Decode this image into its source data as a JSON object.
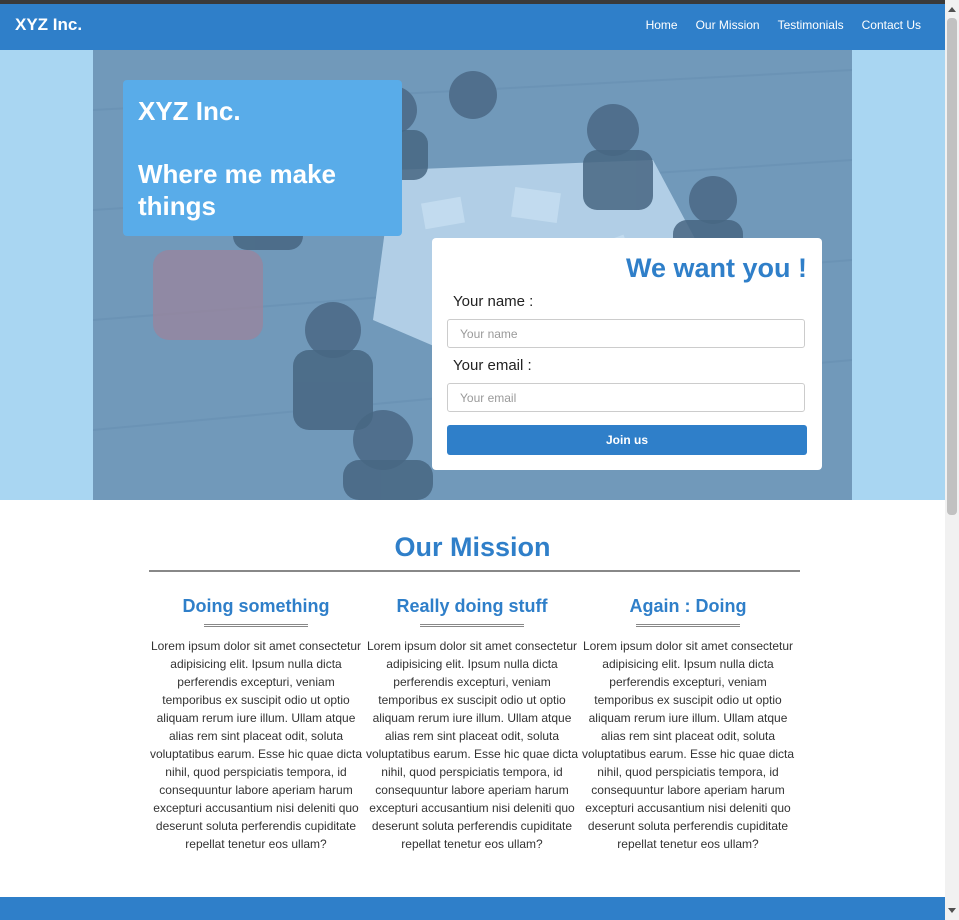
{
  "nav": {
    "brand": "XYZ Inc.",
    "links": [
      "Home",
      "Our Mission",
      "Testimonials",
      "Contact Us"
    ]
  },
  "hero": {
    "intro": {
      "title": "XYZ Inc.",
      "tagline": "Where me make things"
    },
    "form": {
      "title": "We want you !",
      "name_label": "Your name :",
      "name_placeholder": "Your name",
      "email_label": "Your email :",
      "email_placeholder": "Your email",
      "submit_label": "Join us"
    }
  },
  "mission": {
    "title": "Our Mission",
    "columns": [
      {
        "title": "Doing something",
        "text": "Lorem ipsum dolor sit amet consectetur adipisicing elit. Ipsum nulla dicta perferendis excepturi, veniam temporibus ex suscipit odio ut optio aliquam rerum iure illum. Ullam atque alias rem sint placeat odit, soluta voluptatibus earum. Esse hic quae dicta nihil, quod perspiciatis tempora, id consequuntur labore aperiam harum excepturi accusantium nisi deleniti quo deserunt soluta perferendis cupiditate repellat tenetur eos ullam?"
      },
      {
        "title": "Really doing stuff",
        "text": "Lorem ipsum dolor sit amet consectetur adipisicing elit. Ipsum nulla dicta perferendis excepturi, veniam temporibus ex suscipit odio ut optio aliquam rerum iure illum. Ullam atque alias rem sint placeat odit, soluta voluptatibus earum. Esse hic quae dicta nihil, quod perspiciatis tempora, id consequuntur labore aperiam harum excepturi accusantium nisi deleniti quo deserunt soluta perferendis cupiditate repellat tenetur eos ullam?"
      },
      {
        "title": "Again : Doing",
        "text": "Lorem ipsum dolor sit amet consectetur adipisicing elit. Ipsum nulla dicta perferendis excepturi, veniam temporibus ex suscipit odio ut optio aliquam rerum iure illum. Ullam atque alias rem sint placeat odit, soluta voluptatibus earum. Esse hic quae dicta nihil, quod perspiciatis tempora, id consequuntur labore aperiam harum excepturi accusantium nisi deleniti quo deserunt soluta perferendis cupiditate repellat tenetur eos ullam?"
      }
    ]
  },
  "colors": {
    "primary": "#2f7fc9",
    "hero_background": "#a9d6f2",
    "intro_card": "#59ace9"
  }
}
